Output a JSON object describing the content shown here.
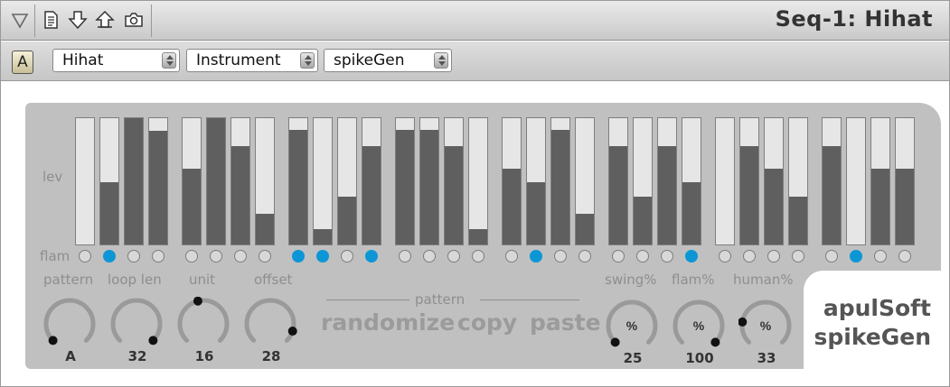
{
  "title": "Seq-1: Hihat",
  "toolbar": {
    "icons": [
      "triangle-down-icon",
      "document-icon",
      "arrow-down-icon",
      "arrow-up-icon",
      "camera-icon"
    ]
  },
  "controls": {
    "a_label": "A",
    "preset": "Hihat",
    "type": "Instrument",
    "plugin": "spikeGen"
  },
  "labels": {
    "lev": "lev",
    "flam": "flam",
    "pattern": "pattern",
    "loop_len": "loop len",
    "unit": "unit",
    "offset": "offset",
    "pattern_group": "pattern",
    "randomize": "randomize",
    "copy": "copy",
    "paste": "paste",
    "swing": "swing%",
    "flam_pct": "flam%",
    "human": "human%",
    "pct": "%"
  },
  "steps": {
    "levels": [
      0,
      0.49,
      1,
      0.9,
      0.6,
      1,
      0.78,
      0.24,
      0.91,
      0.12,
      0.38,
      0.78,
      0.91,
      0.91,
      0.78,
      0.12,
      0.6,
      0.49,
      0.91,
      0.24,
      0.78,
      0.38,
      0.78,
      0.49,
      0,
      0.78,
      0.6,
      0.38,
      0.78,
      0,
      0.6,
      0.6
    ],
    "flam": [
      false,
      true,
      false,
      false,
      false,
      false,
      false,
      false,
      true,
      true,
      false,
      true,
      false,
      false,
      false,
      false,
      false,
      true,
      false,
      false,
      false,
      false,
      false,
      true,
      false,
      false,
      false,
      false,
      false,
      true,
      false,
      false
    ]
  },
  "knobs": [
    {
      "name": "pattern",
      "value": "A",
      "level": 0.0
    },
    {
      "name": "loop len",
      "value": "32",
      "level": 1.0
    },
    {
      "name": "unit",
      "value": "16",
      "level": 0.45
    },
    {
      "name": "offset",
      "value": "28",
      "level": 0.9
    },
    {
      "name": "swing%",
      "value": "25",
      "level": 0.0
    },
    {
      "name": "flam%",
      "value": "100",
      "level": 1.0
    },
    {
      "name": "human%",
      "value": "33",
      "level": 0.2
    }
  ],
  "brand": {
    "line1": "apulSoft",
    "line2": "spikeGen"
  },
  "colors": {
    "accent": "#0d96d6",
    "bar_fill": "#5f5f5f",
    "panel": "#c0c0c0"
  }
}
